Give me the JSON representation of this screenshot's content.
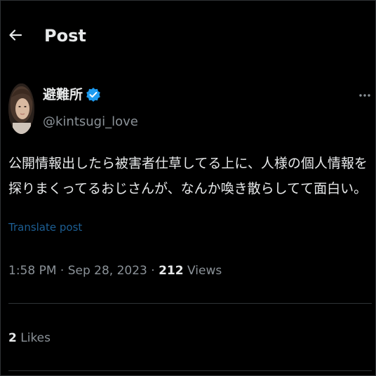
{
  "header": {
    "title": "Post",
    "back_icon": "arrow-left-icon"
  },
  "post": {
    "author": {
      "display_name": "避難所",
      "username": "@kintsugi_love",
      "verified": true,
      "verified_icon": "verified-badge-icon",
      "verified_color": "#1d9bf0"
    },
    "more_icon": "more-horizontal-icon",
    "text": "公開情報出したら被害者仕草してる上に、人様の個人情報を探りまくってるおじさんが、なんか喚き散らしてて面白い。",
    "translate_label": "Translate post",
    "time": "1:58 PM",
    "date": "Sep 28, 2023",
    "separator": "·",
    "views_count": "212",
    "views_label": "Views",
    "likes_count": "2",
    "likes_label": "Likes"
  },
  "colors": {
    "background": "#000000",
    "text_primary": "#e7e9ea",
    "text_secondary": "#8b9298",
    "link": "#1d5f94",
    "divider": "#2f3336"
  }
}
